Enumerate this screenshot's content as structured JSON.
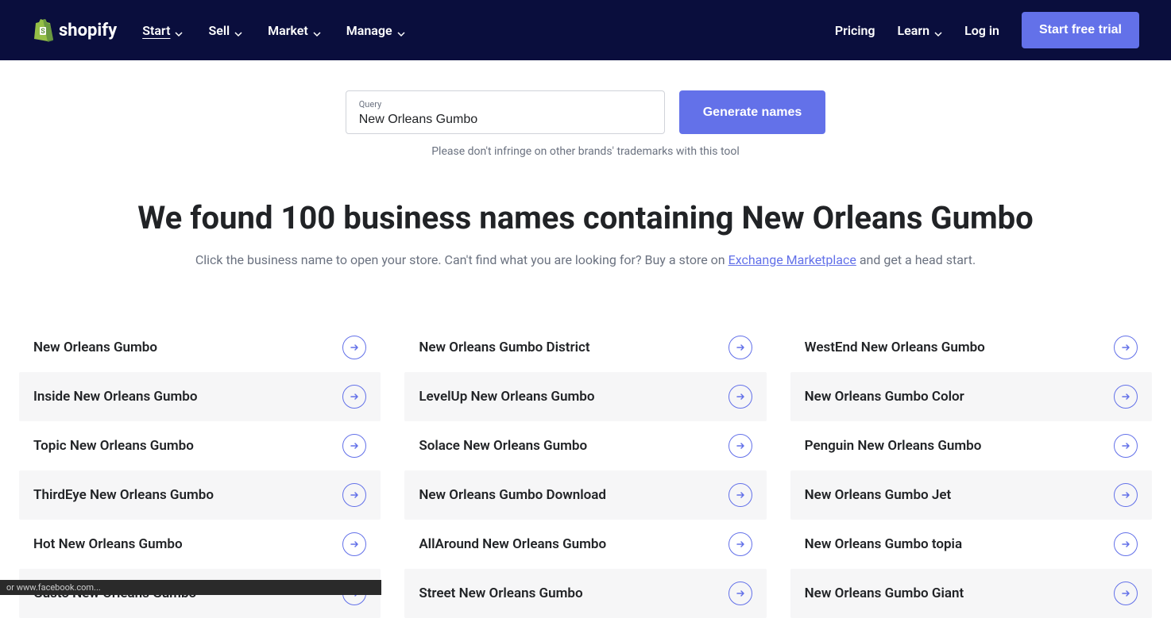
{
  "header": {
    "brand": "shopify",
    "nav": [
      {
        "label": "Start",
        "active": true,
        "dropdown": true
      },
      {
        "label": "Sell",
        "active": false,
        "dropdown": true
      },
      {
        "label": "Market",
        "active": false,
        "dropdown": true
      },
      {
        "label": "Manage",
        "active": false,
        "dropdown": true
      }
    ],
    "pricing": "Pricing",
    "learn": "Learn",
    "login": "Log in",
    "cta": "Start free trial"
  },
  "search": {
    "label": "Query",
    "value": "New Orleans Gumbo",
    "button": "Generate names",
    "disclaimer": "Please don't infringe on other brands' trademarks with this tool"
  },
  "headline": "We found 100 business names containing New Orleans Gumbo",
  "subline_pre": "Click the business name to open your store. Can't find what you are looking for? Buy a store on ",
  "subline_link": "Exchange Marketplace",
  "subline_post": " and get a head start.",
  "results": [
    "New Orleans Gumbo",
    "New Orleans Gumbo District",
    "WestEnd New Orleans Gumbo",
    "Inside New Orleans Gumbo",
    "LevelUp New Orleans Gumbo",
    "New Orleans Gumbo Color",
    "Topic New Orleans Gumbo",
    "Solace New Orleans Gumbo",
    "Penguin New Orleans Gumbo",
    "ThirdEye New Orleans Gumbo",
    "New Orleans Gumbo Download",
    "New Orleans Gumbo Jet",
    "Hot New Orleans Gumbo",
    "AllAround New Orleans Gumbo",
    "New Orleans Gumbo topia",
    "Gusto New Orleans Gumbo",
    "Street New Orleans Gumbo",
    "New Orleans Gumbo Giant"
  ],
  "statusbar": "or www.facebook.com..."
}
